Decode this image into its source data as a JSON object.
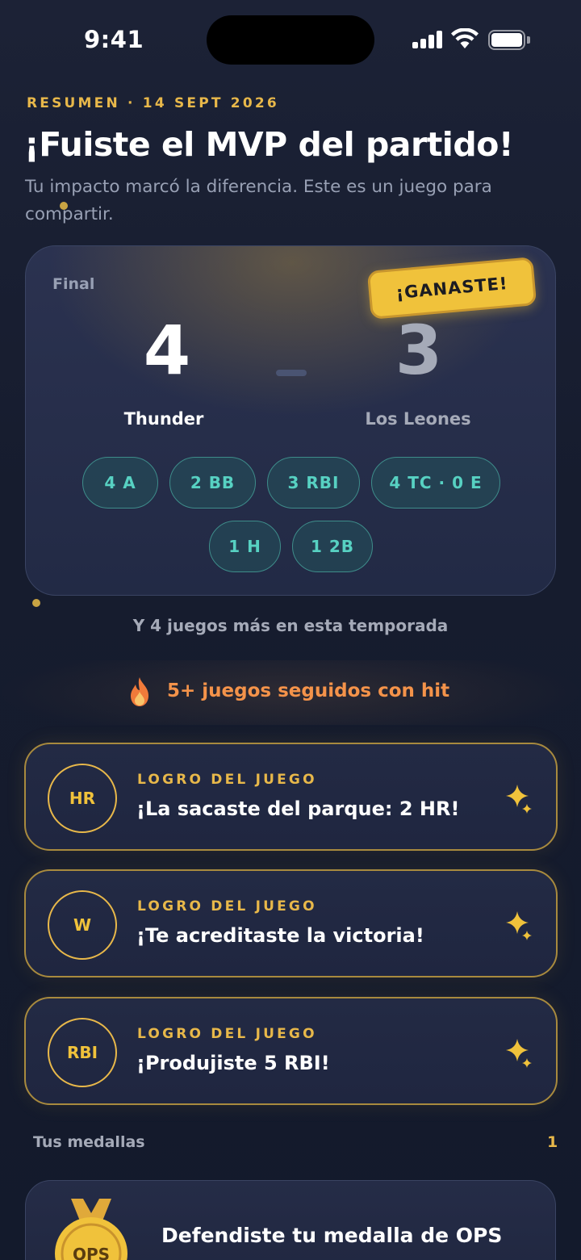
{
  "status_bar": {
    "time": "9:41"
  },
  "header": {
    "eyebrow": "RESUMEN · 14 SEPT 2026",
    "title": "¡Fuiste el MVP del partido!",
    "subtitle": "Tu impacto marcó la diferencia. Este es un juego para compartir."
  },
  "scorecard": {
    "label": "Final",
    "badge": "¡GANASTE!",
    "home": {
      "team": "Thunder",
      "score": "4"
    },
    "away": {
      "team": "Los Leones",
      "score": "3"
    },
    "stats": [
      "4 A",
      "2 BB",
      "3 RBI",
      "4 TC · 0 E",
      "1 H",
      "1 2B"
    ]
  },
  "more_games": "Y 4 juegos más en esta temporada",
  "streak": {
    "text": "5+ juegos seguidos con hit",
    "icon": "flame-icon",
    "color": "#f4934a"
  },
  "achievements": [
    {
      "abbr": "HR",
      "kicker": "LOGRO DEL JUEGO",
      "title": "¡La sacaste del parque: 2 HR!"
    },
    {
      "abbr": "W",
      "kicker": "LOGRO DEL JUEGO",
      "title": "¡Te acreditaste la victoria!"
    },
    {
      "abbr": "RBI",
      "kicker": "LOGRO DEL JUEGO",
      "title": "¡Produjiste 5 RBI!"
    }
  ],
  "medals": {
    "label": "Tus medallas",
    "count": "1",
    "items": [
      {
        "badge": "OPS",
        "title": "Defendiste tu medalla de OPS"
      }
    ]
  },
  "colors": {
    "accent": "#e8b84a",
    "badge": "#f0c23b",
    "chip_text": "#57d1c2",
    "background": "#141a2b"
  }
}
